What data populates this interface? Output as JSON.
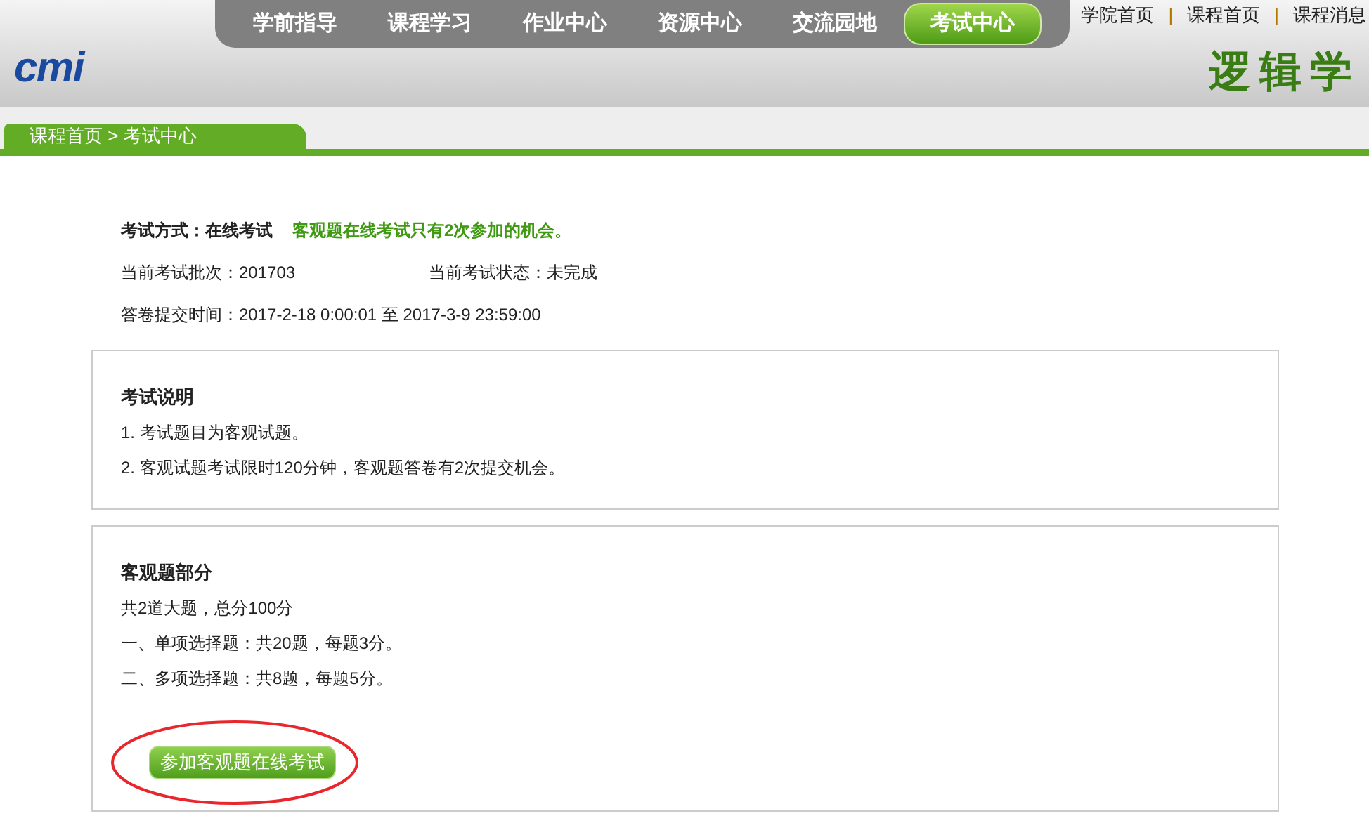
{
  "logo": "cmi",
  "nav": [
    {
      "label": "学前指导",
      "selected": false
    },
    {
      "label": "课程学习",
      "selected": false
    },
    {
      "label": "作业中心",
      "selected": false
    },
    {
      "label": "资源中心",
      "selected": false
    },
    {
      "label": "交流园地",
      "selected": false
    },
    {
      "label": "考试中心",
      "selected": true
    }
  ],
  "top_links": [
    "学院首页",
    "课程首页",
    "课程消息"
  ],
  "top_link_separators": [
    "|",
    "|"
  ],
  "course_title": "逻辑学",
  "breadcrumb": "课程首页 > 考试中心",
  "exam_info": {
    "mode": "考试方式：在线考试",
    "notice": "客观题在线考试只有2次参加的机会。",
    "batch": "当前考试批次：201703",
    "status": "当前考试状态：未完成",
    "time": "答卷提交时间：2017-2-18 0:00:01 至 2017-3-9 23:59:00"
  },
  "panels": [
    {
      "title": "考试说明",
      "lines": [
        "1. 考试题目为客观试题。",
        "2. 客观试题考试限时120分钟，客观题答卷有2次提交机会。"
      ]
    },
    {
      "title": "客观题部分",
      "lines": [
        "共2道大题，总分100分",
        "一、单项选择题：共20题，每题3分。",
        "二、多项选择题：共8题，每题5分。"
      ],
      "button": "参加客观题在线考试"
    }
  ]
}
